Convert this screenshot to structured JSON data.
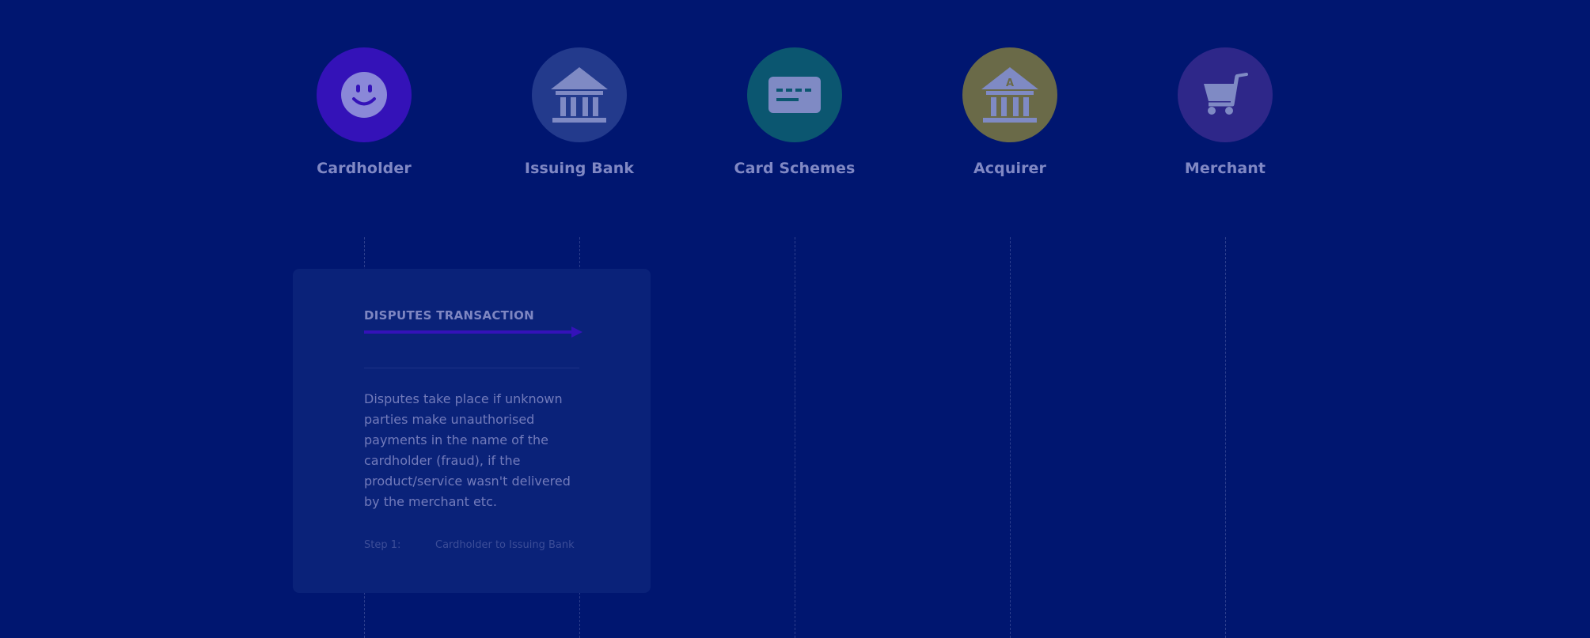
{
  "actors": [
    {
      "label": "Cardholder",
      "icon": "smiley-icon",
      "color": "#3412b8"
    },
    {
      "label": "Issuing Bank",
      "icon": "bank-icon",
      "color": "#233a8c"
    },
    {
      "label": "Card Schemes",
      "icon": "card-icon",
      "color": "#0b5670"
    },
    {
      "label": "Acquirer",
      "icon": "acquirer-bank-icon",
      "color": "#6a6a48"
    },
    {
      "label": "Merchant",
      "icon": "shopping-cart-icon",
      "color": "#2e2789"
    }
  ],
  "card": {
    "title": "DISPUTES TRANSACTION",
    "description": "Disputes take place if unknown parties make unauthorised payments in the name of the cardholder (fraud), if the product/service wasn't delivered by the merchant etc.",
    "step_label": "Step 1:",
    "step_text": "Cardholder to Issuing Bank",
    "arrow_color": "#3412b8"
  }
}
